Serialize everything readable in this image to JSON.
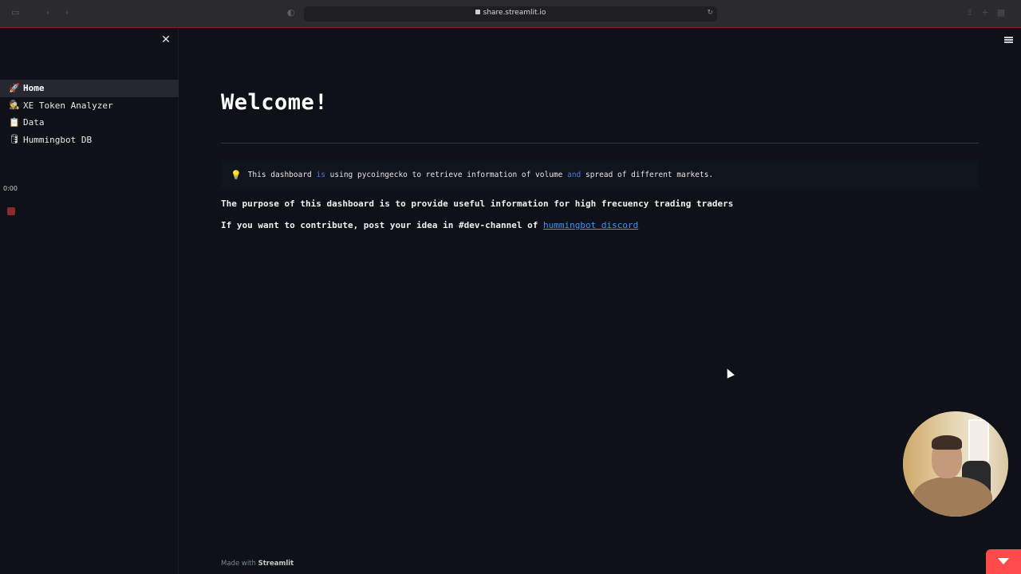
{
  "browser": {
    "url": "share.streamlit.io"
  },
  "sidebar": {
    "items": [
      {
        "icon": "rocket-icon",
        "glyph": "🚀",
        "label": "Home",
        "active": true
      },
      {
        "icon": "detective-icon",
        "glyph": "🕵",
        "label": "XE Token Analyzer",
        "active": false
      },
      {
        "icon": "clipboard-icon",
        "glyph": "📋",
        "label": "Data",
        "active": false
      },
      {
        "icon": "database-icon",
        "glyph": "🛢",
        "label": "Hummingbot DB",
        "active": false
      }
    ],
    "time": "0:00"
  },
  "main": {
    "title": "Welcome!",
    "info": {
      "icon": "lightbulb-icon",
      "part1": "This dashboard ",
      "kw1": "is",
      "part2": " using pycoingecko to retrieve information of volume ",
      "kw2": "and",
      "part3": " spread of different markets."
    },
    "paragraph1": "The purpose of this dashboard is to provide useful information for high frecuency trading traders",
    "paragraph2_prefix": "If you want to contribute, post your idea in #dev-channel of ",
    "paragraph2_link": "hummingbot discord",
    "footer_prefix": "Made with ",
    "footer_brand": "Streamlit"
  },
  "colors": {
    "background": "#0e1117",
    "sidebar_active": "#262730",
    "link": "#4d8ff5",
    "keyword": "#4d79d9",
    "accent": "#ff4b4b"
  }
}
